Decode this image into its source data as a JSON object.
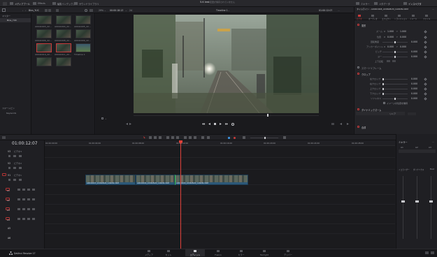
{
  "topbar": {
    "media_pool_label": "メディアプール",
    "effects_label": "Effects",
    "edit_index_label": "編集インデックス",
    "sound_library_label": "サウンドライブラリ",
    "project_name": "5.K test",
    "project_status": "変更が保存されていません",
    "mixer_label": "ミキサー",
    "metadata_label": "メタデータ",
    "inspector_label": "インスペクタ"
  },
  "subbar": {
    "bin_path": "Bins_YUC",
    "zoom": "29%",
    "timecode_duration": "00:00:18:13",
    "fps": "24",
    "timeline_name": "Timeline 1",
    "timecode_current": "01:00:12:07",
    "inspector_clip": "タイムライン - A004C008_220628LM_CANON.CRM"
  },
  "bins": {
    "master": "マスター",
    "bin_item": "Bins_YUC",
    "smart_bins": "スマートビン",
    "keywords": "Keywords"
  },
  "pool": {
    "thumbs": [
      {
        "label": "A004C003_22..."
      },
      {
        "label": "A004C004_22..."
      },
      {
        "label": "A004C005_22..."
      },
      {
        "label": "A004C006_22..."
      },
      {
        "label": "A004C008_22..."
      },
      {
        "label": "A004C009_22..."
      },
      {
        "label": "A004C010_22..."
      },
      {
        "label": "A004C011_22..."
      },
      {
        "label": "Timeline 1"
      }
    ]
  },
  "inspector": {
    "tabs": [
      "ビデオ",
      "オーディオ",
      "エフェクト",
      "トランジション",
      "イメージ",
      "ファイル"
    ],
    "section_transform": "変形",
    "zoom_label": "ズーム",
    "zoom_x": "1.000",
    "zoom_y": "1.000",
    "position_label": "位置",
    "position_x": "0.000",
    "position_y": "0.000",
    "rotation_label": "回転角度",
    "rotation_val": "0.000",
    "anchor_label": "アンカーポイント",
    "anchor_x": "0.000",
    "anchor_y": "0.000",
    "pitch_label": "ピッチ",
    "pitch_val": "0.000",
    "yaw_label": "ヨー",
    "yaw_val": "0.000",
    "flip_label": "上下反転",
    "section_smart_reframe": "スマートリフレーム",
    "section_crop": "クロップ",
    "crop_left_label": "左クロップ",
    "crop_left": "0.000",
    "crop_right_label": "右クロップ",
    "crop_right": "0.000",
    "crop_top_label": "上クロップ",
    "crop_top": "0.000",
    "crop_bottom_label": "下クロップ",
    "crop_bottom": "0.000",
    "softness_label": "ソフトネス",
    "softness_val": "0.000",
    "retain_label": "イメージの位置を維持",
    "section_dynamic_zoom": "ダイナミックズーム",
    "dz_ease_label": "リニア",
    "section_composite": "合成"
  },
  "viewer": {
    "controls": [
      "◀◀",
      "◀",
      "■",
      "▶",
      "▶▶",
      "⟲"
    ]
  },
  "timeline": {
    "ruler_ticks": [
      "01:00:00:00",
      "01:00:04:00",
      "01:00:08:00",
      "01:00:12:00",
      "01:00:16:00",
      "01:00:20:00",
      "01:00:24:00",
      "01:00:28:00"
    ],
    "timecode": "01:00:12:07",
    "tracks": [
      {
        "id": "V3",
        "name": "ビデオ3"
      },
      {
        "id": "V2",
        "name": "ビデオ2"
      },
      {
        "id": "V1",
        "name": "ビデオ1"
      },
      {
        "id": "A1",
        "name": ""
      },
      {
        "id": "A2",
        "name": ""
      },
      {
        "id": "A3",
        "name": ""
      },
      {
        "id": "A4",
        "name": ""
      },
      {
        "id": "A5",
        "name": ""
      },
      {
        "id": "A6",
        "name": ""
      }
    ],
    "clips": [
      {
        "name": "A004C003_220628LM_CANON.CRM"
      },
      {
        "name": "A004C006_220628LM_CANON.CRM"
      },
      {
        "name": "A004C008_220628LM_CANON.CRM"
      }
    ]
  },
  "mixer": {
    "title": "ミキサー",
    "channels": [
      "A1",
      "A2",
      "A3"
    ],
    "bus": "Bus1",
    "eq_label": "イコライザー",
    "dyn_label": "ダイナミクス"
  },
  "bottom": {
    "app_name": "DaVinci Resolve 17",
    "pages": [
      {
        "label": "メディア",
        "active": false
      },
      {
        "label": "カット",
        "active": false
      },
      {
        "label": "エディット",
        "active": true
      },
      {
        "label": "Fusion",
        "active": false
      },
      {
        "label": "カラー",
        "active": false
      },
      {
        "label": "Fairlight",
        "active": false
      },
      {
        "label": "デリバー",
        "active": false
      }
    ]
  },
  "colors": {
    "accent_red": "#c83a3a",
    "clip_blue": "#2c5878",
    "playhead": "#e0413a"
  }
}
